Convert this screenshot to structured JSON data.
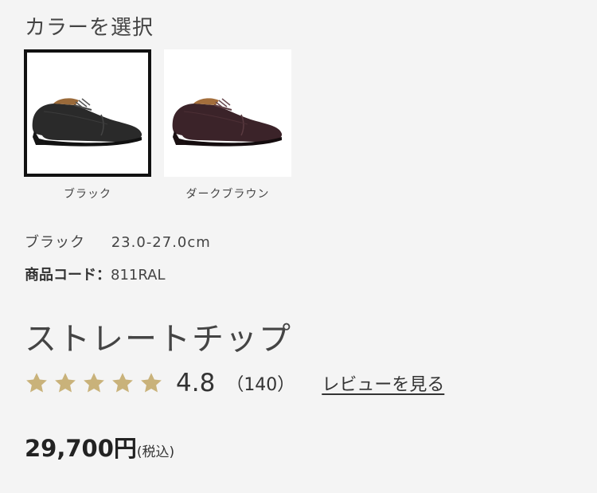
{
  "color_section": {
    "title": "カラーを選択"
  },
  "swatches": [
    {
      "label": "ブラック",
      "selected": true,
      "color": "#2a2a2a"
    },
    {
      "label": "ダークブラウン",
      "selected": false,
      "color": "#3b2329"
    }
  ],
  "selection": {
    "color_name": "ブラック",
    "size_range": "23.0-27.0cm"
  },
  "product": {
    "code_label": "商品コード：",
    "code": "811RAL",
    "name": "ストレートチップ"
  },
  "rating": {
    "value": "4.8",
    "count": "（140）",
    "stars": 5,
    "star_color": "#c9b27a",
    "review_link": "レビューを見る"
  },
  "price": {
    "amount": "29,700円",
    "tax_label": "(税込)"
  }
}
